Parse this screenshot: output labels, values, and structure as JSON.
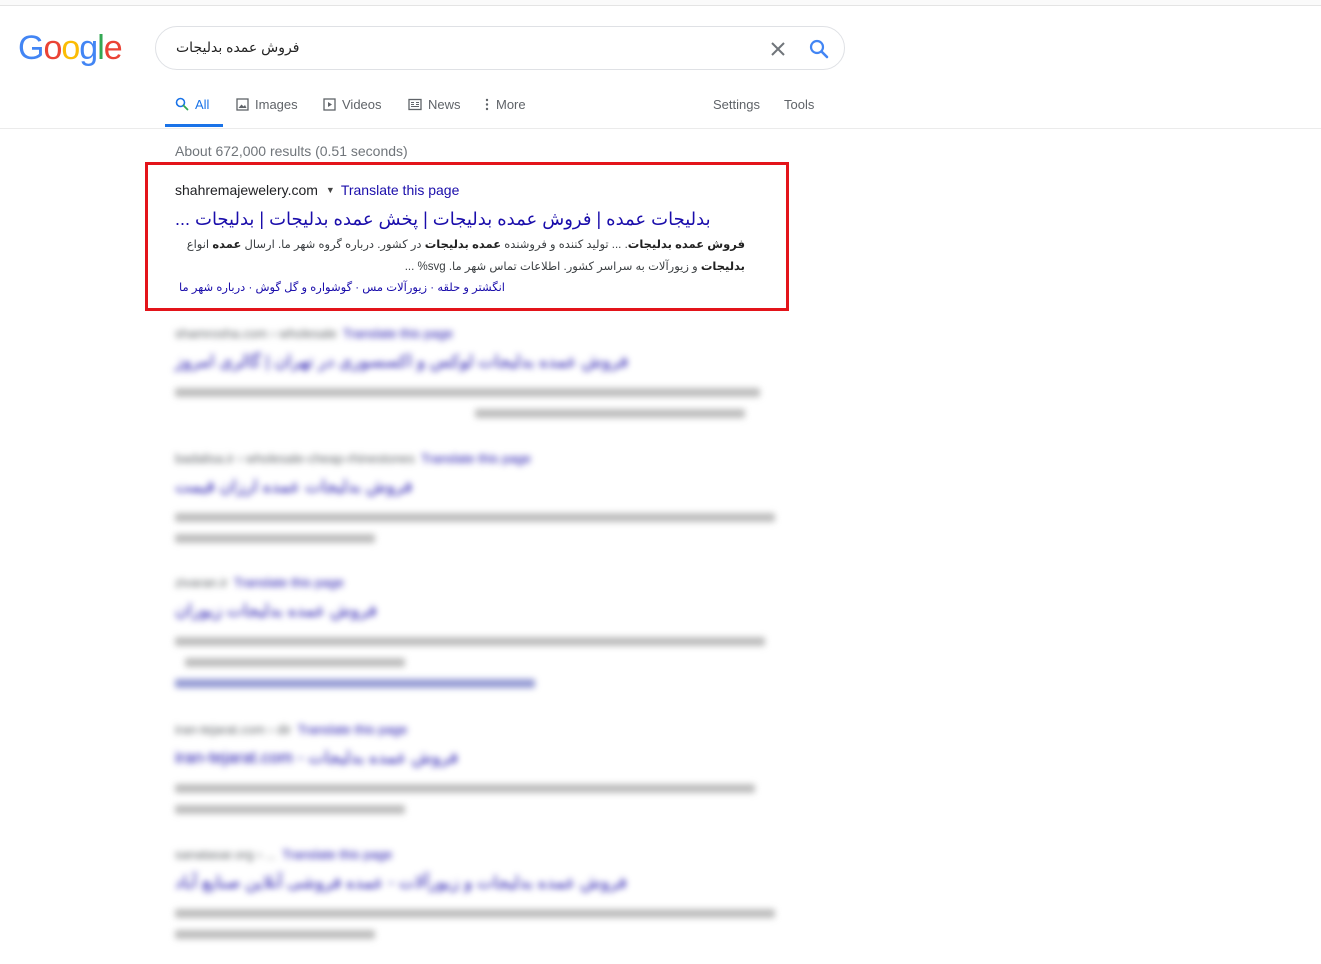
{
  "header": {
    "logo_letters": [
      {
        "char": "G",
        "color": "#4285F4"
      },
      {
        "char": "o",
        "color": "#EA4335"
      },
      {
        "char": "o",
        "color": "#FBBC05"
      },
      {
        "char": "g",
        "color": "#4285F4"
      },
      {
        "char": "l",
        "color": "#34A853"
      },
      {
        "char": "e",
        "color": "#EA4335"
      }
    ],
    "search": {
      "query": "فروش عمده بدلیجات",
      "clear_icon": "close-icon",
      "search_icon": "search-icon"
    }
  },
  "tabs": {
    "all": "All",
    "images": "Images",
    "videos": "Videos",
    "news": "News",
    "more": "More",
    "settings": "Settings",
    "tools": "Tools",
    "accent_color": "#1a73e8"
  },
  "results": {
    "stats": "About 672,000 results (0.51 seconds)",
    "highlighted": {
      "site": "shahremajewelery.com",
      "translate": "Translate this page",
      "title": "بدلیجات عمده | فروش عمده بدلیجات | پخش عمده بدلیجات | بدلیجات ...",
      "snippet_bold_1": "فروش عمده بدلیجات",
      "snippet_text_1": ". ... تولید کننده و فروشنده ",
      "snippet_bold_2": "عمده بدلیجات",
      "snippet_text_2": " در کشور. درباره گروه شهر ما. ارسال ",
      "snippet_bold_3": "عمده",
      "snippet_text_3": " انواع ",
      "snippet_bold_4": "بدلیجات",
      "snippet_text_4": " و زیورآلات به سراسر کشور. اطلاعات تماس شهر ما. svg% ...",
      "sitelinks": "انگشتر و حلقه · زیورآلات مس · گوشواره و گل گوش · درباره شهر ما",
      "box_color": "#e3141a"
    },
    "blurred": [
      {
        "cite": "shamrosha.com › wholesale",
        "translate": "Translate this page",
        "title": "فروش عمده بدلیجات لوکس و اکسسوری در تهران | گالری امروز"
      },
      {
        "cite": "badalisa.ir › wholesale-cheap-rhinestones",
        "translate": "Translate this page",
        "title": "فروش بدلیجات عمده ارزان قیمت"
      },
      {
        "cite": "zivaran.ir",
        "translate": "Translate this page",
        "title": "فروش عمده بدلیجات زیوران"
      },
      {
        "cite": "iran-tejarat.com › dir",
        "translate": "Translate this page",
        "title": "iran-tejarat.com - فروش عمده بدلیجات"
      },
      {
        "cite": "sanatasar.org › ...",
        "translate": "Translate this page",
        "title": "فروش عمده بدلیجات و زیورآلات - عمده فروشی آنلاین صنایع آباد"
      }
    ]
  }
}
